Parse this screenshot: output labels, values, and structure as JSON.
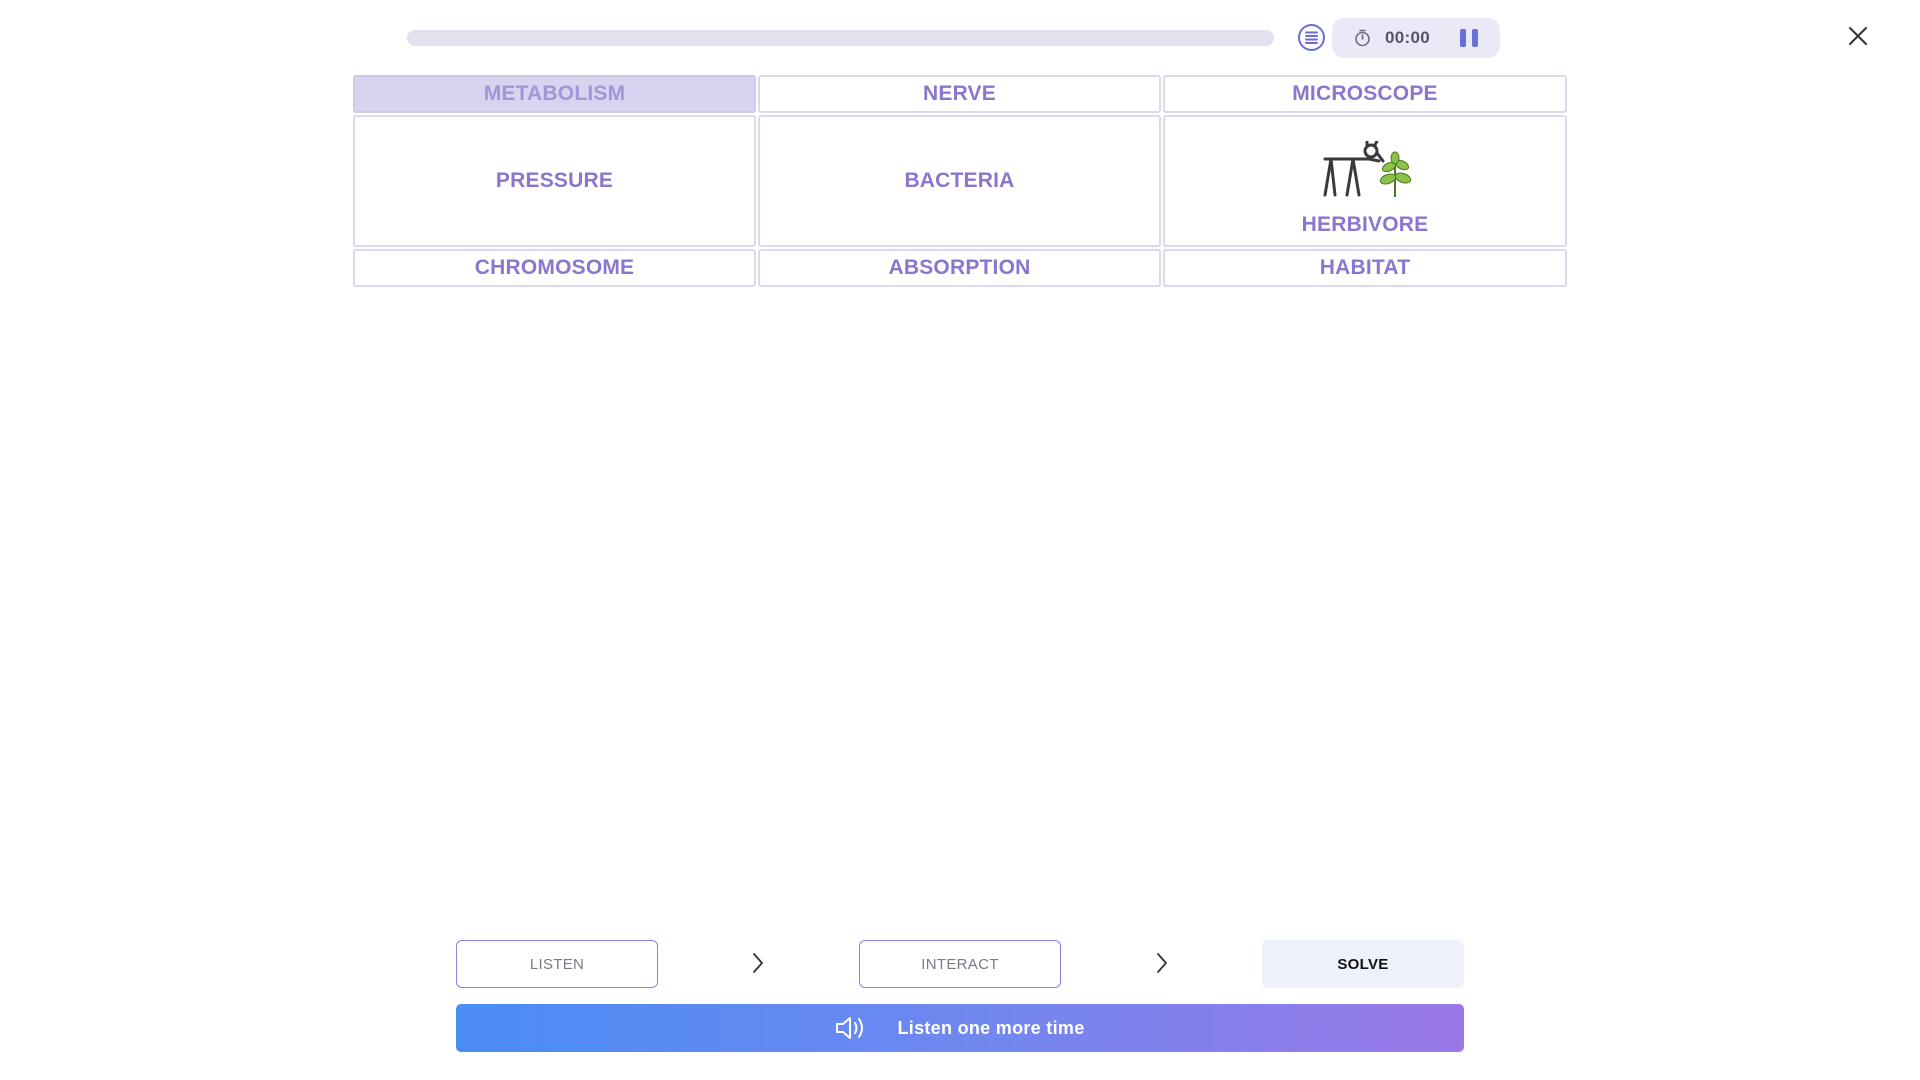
{
  "progress": {
    "fraction": 0.0
  },
  "timer": {
    "time": "00:00"
  },
  "grid": {
    "cells": [
      {
        "label": "METABOLISM",
        "selected": true
      },
      {
        "label": "NERVE"
      },
      {
        "label": "MICROSCOPE"
      },
      {
        "label": "PRESSURE"
      },
      {
        "label": "BACTERIA"
      },
      {
        "label": "HERBIVORE",
        "icon": "herbivore-picture-icon"
      },
      {
        "label": "CHROMOSOME"
      },
      {
        "label": "ABSORPTION"
      },
      {
        "label": "HABITAT"
      }
    ]
  },
  "steps": {
    "listen": "LISTEN",
    "interact": "INTERACT",
    "solve": "SOLVE"
  },
  "listen_button": {
    "label": "Listen one more time"
  },
  "colors": {
    "accent": "#8a76cf",
    "selected_bg": "#d9d3ef",
    "gradient_start": "#4a8cf5",
    "gradient_end": "#9a78e6"
  }
}
